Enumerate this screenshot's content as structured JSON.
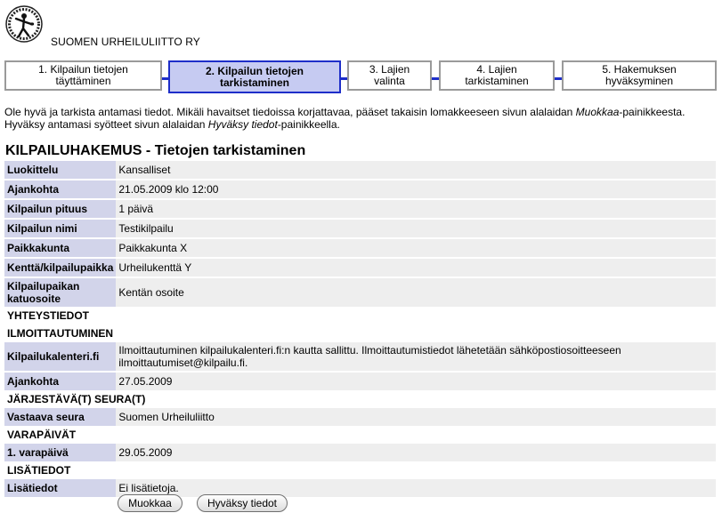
{
  "header": {
    "org_name": "SUOMEN URHEILULIITTO RY",
    "logo_icon": "discus-thrower-logo-icon"
  },
  "steps": [
    {
      "label": "1. Kilpailun tietojen\ntäyttäminen",
      "active": false
    },
    {
      "label": "2. Kilpailun tietojen\ntarkistaminen",
      "active": true
    },
    {
      "label": "3. Lajien\nvalinta",
      "active": false
    },
    {
      "label": "4. Lajien\ntarkistaminen",
      "active": false
    },
    {
      "label": "5. Hakemuksen\nhyväksyminen",
      "active": false
    }
  ],
  "intro": {
    "line1_a": "Ole hyvä ja tarkista antamasi tiedot. Mikäli havaitset tiedoissa korjattavaa, pääset takaisin lomakkeeseen sivun alalaidan ",
    "line1_em": "Muokkaa",
    "line1_b": "-painikkeesta.",
    "line2_a": "Hyväksy antamasi syötteet sivun alalaidan ",
    "line2_em": "Hyväksy tiedot",
    "line2_b": "-painikkeella."
  },
  "page_title": "KILPAILUHAKEMUS - Tietojen tarkistaminen",
  "fields": {
    "luokittelu": {
      "label": "Luokittelu",
      "value": "Kansalliset"
    },
    "ajankohta": {
      "label": "Ajankohta",
      "value": "21.05.2009 klo 12:00"
    },
    "pituus": {
      "label": "Kilpailun pituus",
      "value": "1 päivä"
    },
    "nimi": {
      "label": "Kilpailun nimi",
      "value": "Testikilpailu"
    },
    "paikkakunta": {
      "label": "Paikkakunta",
      "value": "Paikkakunta X"
    },
    "kentta": {
      "label": "Kenttä/kilpailupaikka",
      "value": "Urheilukenttä Y"
    },
    "katuosoite": {
      "label": "Kilpailupaikan katuosoite",
      "value": "Kentän osoite"
    },
    "section_yhteystiedot": "YHTEYSTIEDOT",
    "section_ilmoittautuminen": "ILMOITTAUTUMINEN",
    "kilpailukalenteri": {
      "label": "Kilpailukalenteri.fi",
      "value": "Ilmoittautuminen kilpailukalenteri.fi:n kautta sallittu. Ilmoittautumistiedot lähetetään sähköpostiosoitteeseen ilmoittautumiset@kilpailu.fi."
    },
    "ilm_ajankohta": {
      "label": "Ajankohta",
      "value": "27.05.2009"
    },
    "section_jarjestaja": "JÄRJESTÄVÄ(T) SEURA(T)",
    "vastaava_seura": {
      "label": "Vastaava seura",
      "value": "Suomen Urheiluliitto"
    },
    "section_varapaivat": "VARAPÄIVÄT",
    "varapaiva1": {
      "label": "1. varapäivä",
      "value": "29.05.2009"
    },
    "section_lisatiedot": "LISÄTIEDOT",
    "lisatiedot": {
      "label": "Lisätiedot",
      "value": "Ei lisätietoja."
    }
  },
  "buttons": {
    "edit_label": "Muokkaa",
    "approve_label": "Hyväksy tiedot"
  }
}
